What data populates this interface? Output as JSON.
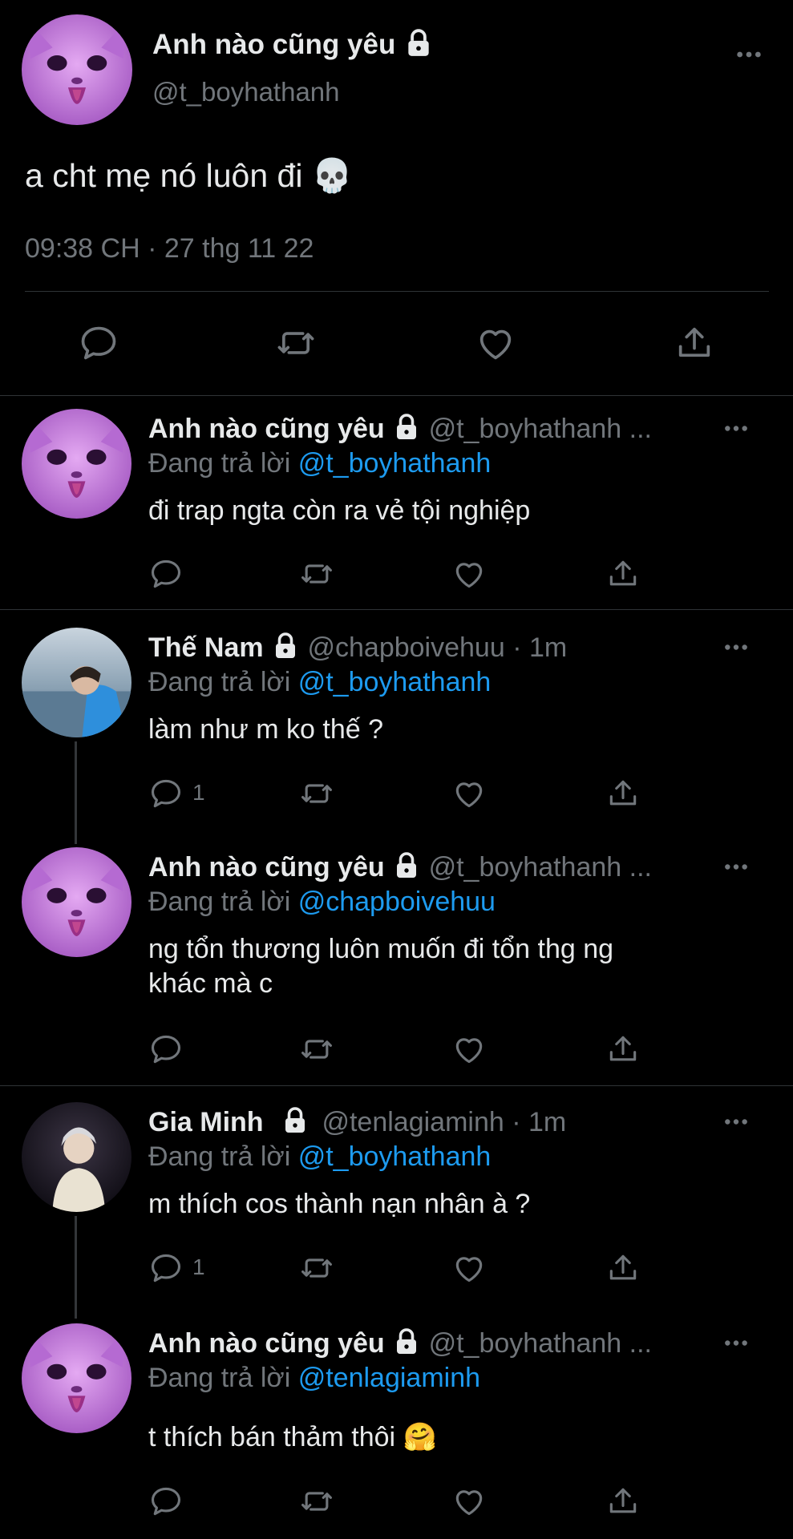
{
  "main_tweet": {
    "display_name": "Anh nào cũng yêu",
    "handle": "@t_boyhathanh",
    "text": "a cht mẹ nó luôn đi 💀",
    "timestamp": "09:38 CH · 27 thg 11 22"
  },
  "replies": [
    {
      "display_name": "Anh nào cũng yêu",
      "handle": "@t_boyhathanh ...",
      "replying_prefix": "Đang trả lời ",
      "replying_to": "@t_boyhathanh",
      "text": "đi trap ngta còn ra vẻ tội nghiệp",
      "reply_count": ""
    },
    {
      "display_name": "Thế Nam",
      "handle": "@chapboivehuu · 1m",
      "replying_prefix": "Đang trả lời ",
      "replying_to": "@t_boyhathanh",
      "text": "làm như m ko thế ?",
      "reply_count": "1"
    },
    {
      "display_name": "Anh nào cũng yêu",
      "handle": "@t_boyhathanh ...",
      "replying_prefix": "Đang trả lời ",
      "replying_to": "@chapboivehuu",
      "text_line1": "ng tổn thương luôn muốn đi tổn thg ng",
      "text_line2": "khác mà c",
      "reply_count": ""
    },
    {
      "display_name": "Gia Minh",
      "handle": "@tenlagiaminh · 1m",
      "replying_prefix": "Đang trả lời ",
      "replying_to": "@t_boyhathanh",
      "text": "m thích cos thành nạn nhân à ?",
      "reply_count": "1"
    },
    {
      "display_name": "Anh nào cũng yêu",
      "handle": "@t_boyhathanh ...",
      "replying_prefix": "Đang trả lời ",
      "replying_to": "@tenlagiaminh",
      "text": "t thích bán thảm thôi 🤗",
      "reply_count": ""
    }
  ],
  "colors": {
    "background": "#000000",
    "text": "#e7e9ea",
    "muted": "#71767b",
    "link": "#1d9bf0",
    "divider": "#2f3336",
    "avatar_cat": "#c77ce0"
  },
  "icons": [
    "lock-icon",
    "more-icon",
    "reply-icon",
    "retweet-icon",
    "like-icon",
    "share-icon"
  ]
}
